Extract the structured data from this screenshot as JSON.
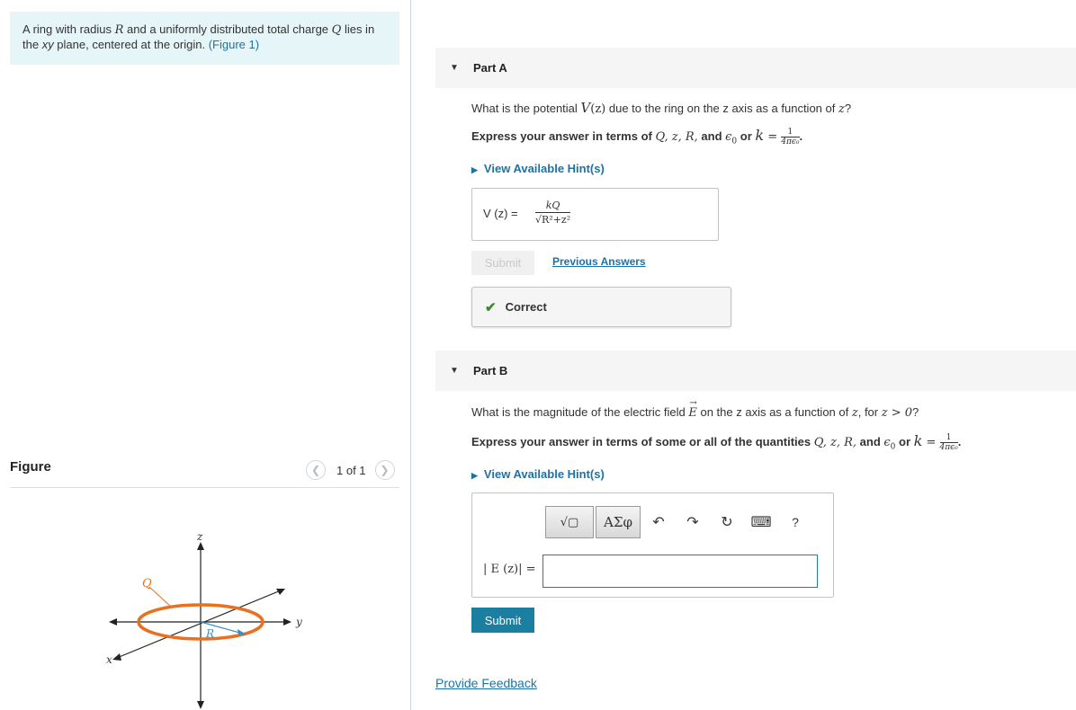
{
  "intro": {
    "text_before_R": "A ring with radius ",
    "R": "R",
    "text_before_Q": " and a uniformly distributed total charge ",
    "Q": "Q",
    "text_after_Q": " lies in the ",
    "xy": "xy",
    "text_end": " plane, centered at the origin. ",
    "figure_link": "(Figure 1)"
  },
  "figure_panel": {
    "title": "Figure",
    "counter": "1 of 1",
    "prev_icon": "chevron-left-icon",
    "next_icon": "chevron-right-icon",
    "labels": {
      "z": "z",
      "y": "y",
      "x": "x",
      "Q": "Q",
      "R": "R"
    }
  },
  "partA": {
    "label": "Part A",
    "question": {
      "pre": "What is the potential ",
      "V": "V",
      "z": "(z)",
      "mid": " due to the ring on the z axis as a function of ",
      "z2": "z",
      "end": "?"
    },
    "express": {
      "pre": "Express your answer in terms of ",
      "vars": "Q, z, R,",
      "and": " and ",
      "eps": "ϵ",
      "eps_sub": "0",
      "or": " or ",
      "k": "k",
      "eq": " = ",
      "frac_num": "1",
      "frac_den": "4πϵ₀",
      "dot": "."
    },
    "hint": "View Available Hint(s)",
    "answer_lhs": "V (z) =",
    "answer_num": "kQ",
    "answer_den": "√R²+z²",
    "submit": "Submit",
    "previous_answers": "Previous Answers",
    "result": "Correct"
  },
  "partB": {
    "label": "Part B",
    "question": {
      "pre": "What is the magnitude of the electric field ",
      "E": "E",
      "mid": " on the z axis as a function of ",
      "z": "z",
      "cond": ", for ",
      "ineq": "z > 0",
      "end": "?"
    },
    "express": {
      "pre": "Express your answer in terms of some or all of the quantities ",
      "vars": "Q, z, R,",
      "and": " and ",
      "eps": "ϵ",
      "eps_sub": "0",
      "or": " or ",
      "k": "k",
      "eq": " = ",
      "frac_num": "1",
      "frac_den": "4πϵ₀",
      "dot": "."
    },
    "hint": "View Available Hint(s)",
    "toolbar": {
      "template_label": "√▢",
      "greek_label": "ΑΣφ",
      "undo_icon": "↶",
      "redo_icon": "↷",
      "reset_icon": "↻",
      "keyboard_icon": "⌨",
      "help_icon": "?"
    },
    "eq_label": "| E (z)| =",
    "input_value": "",
    "submit": "Submit"
  },
  "feedback": "Provide Feedback",
  "colors": {
    "accent": "#1a7fa0",
    "link": "#1a73a8",
    "ring": "#e8701e",
    "radius": "#3a8fc8",
    "correct": "#3a8a2c",
    "intro_bg": "#e6f5f8"
  }
}
